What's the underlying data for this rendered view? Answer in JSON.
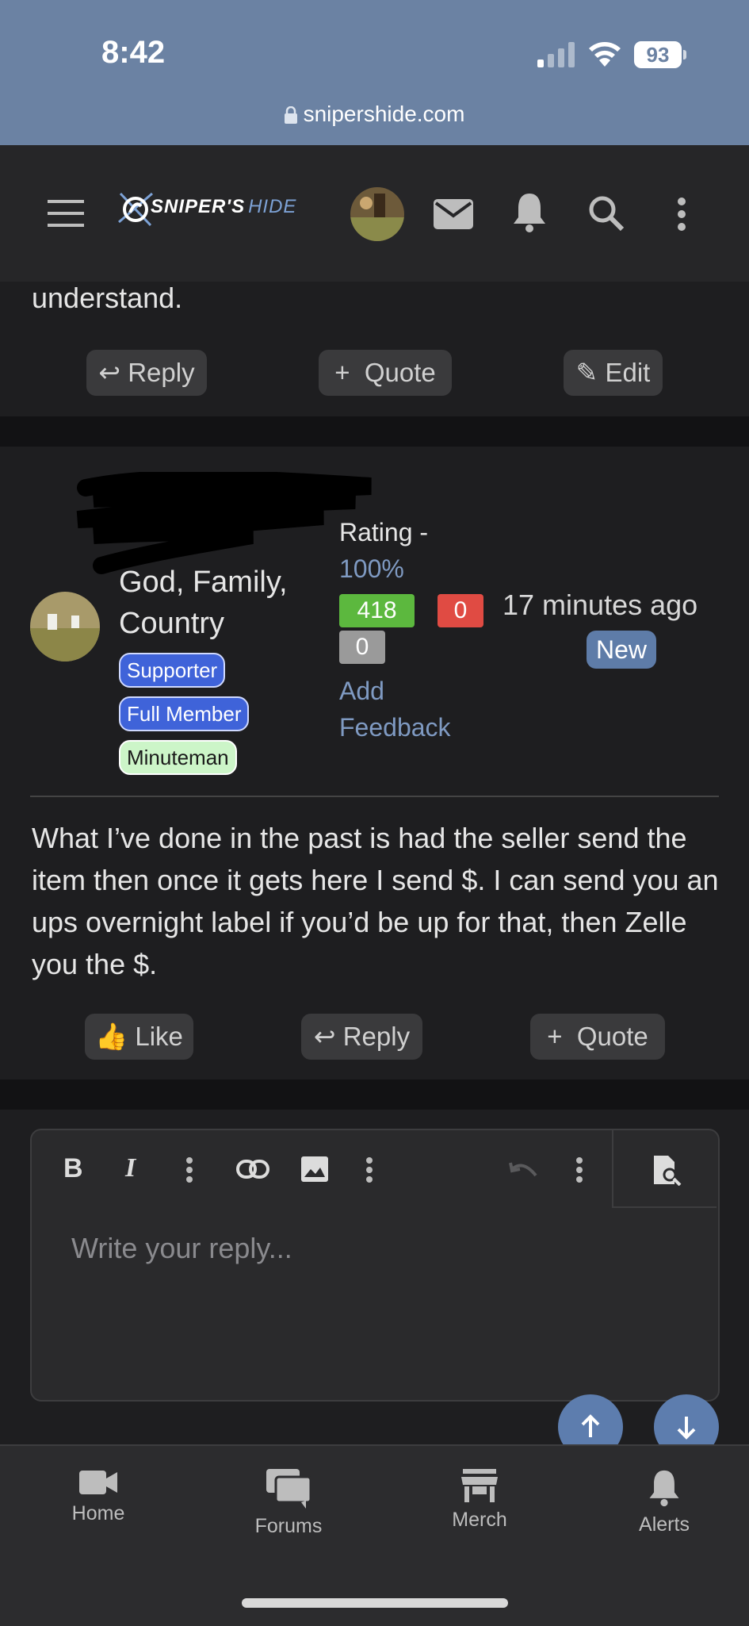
{
  "status_bar": {
    "time": "8:42",
    "battery": "93",
    "url": "snipershide.com"
  },
  "header": {
    "logo_left": "SNIPER'S",
    "logo_right": "HIDE"
  },
  "previous_post": {
    "text_tail": "understand.",
    "actions": {
      "reply": "Reply",
      "quote": "Quote",
      "edit": "Edit"
    }
  },
  "post": {
    "user_title": [
      "God, Family,",
      "Country"
    ],
    "badges": [
      "Supporter",
      "Full Member",
      "Minuteman"
    ],
    "rating": {
      "label": "Rating -",
      "percent": "100%",
      "positive": "418",
      "negative": "0",
      "neutral": "0",
      "add_feedback": [
        "Add",
        "Feedback"
      ]
    },
    "time_ago": "17 minutes ago",
    "new_badge": "New",
    "body": "What I’ve done in the past is had the seller send the item then once it gets here I send $. I can send you an ups overnight label if you’d be up for that, then Zelle you the $.",
    "actions": {
      "like": "Like",
      "reply": "Reply",
      "quote": "Quote"
    }
  },
  "editor": {
    "placeholder": "Write your reply..."
  },
  "bottom_nav": [
    {
      "label": "Home",
      "icon": "video-camera-icon"
    },
    {
      "label": "Forums",
      "icon": "chat-bubbles-icon"
    },
    {
      "label": "Merch",
      "icon": "store-icon"
    },
    {
      "label": "Alerts",
      "icon": "bell-icon"
    }
  ],
  "colors": {
    "status_bar": "#6b82a3",
    "accent": "#7f9ac2",
    "positive": "#5cb83e",
    "negative": "#e04b43",
    "neutral": "#9a9a9a"
  }
}
